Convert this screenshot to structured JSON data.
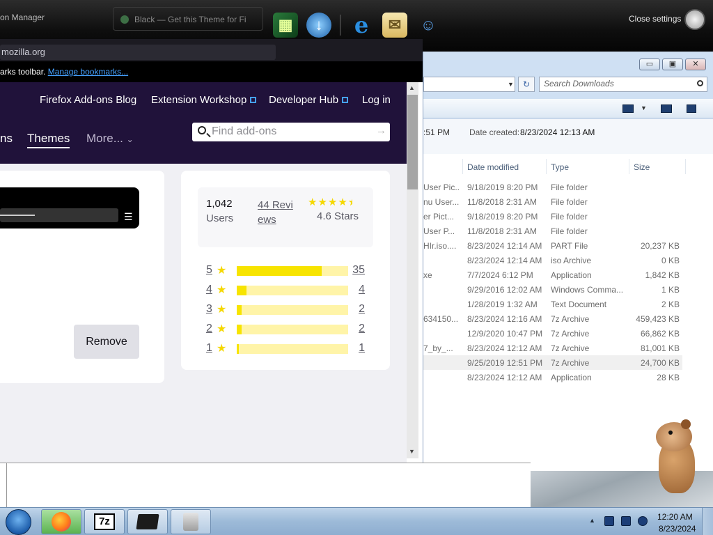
{
  "top_bar": {
    "firefox_tab_title": "on Manager",
    "ghost_tab_title": "Black — Get this Theme for Fi",
    "dock_icons": [
      "cube-app-icon",
      "globe-download-icon",
      "internet-explorer-icon",
      "mail-envelope-icon",
      "users-icon"
    ],
    "close_settings": "Close settings"
  },
  "firefox": {
    "url_text": "mozilla.org",
    "bookmarks_text": "arks toolbar.",
    "manage_bookmarks": "Manage bookmarks...",
    "header_links": [
      "Firefox Add-ons Blog",
      "Extension Workshop",
      "Developer Hub",
      "Log in"
    ],
    "nav": {
      "extensions_partial": "ns",
      "themes": "Themes",
      "more": "More..."
    },
    "search_placeholder": "Find add-ons",
    "remove_button": "Remove",
    "stats": {
      "users_count": "1,042",
      "users_label": "Users",
      "reviews_link": "44 Reviews",
      "stars_label": "4.6 Stars",
      "star_rating": 4.6
    },
    "ratings": [
      {
        "stars": "5",
        "count": "35",
        "fraction": 0.76
      },
      {
        "stars": "4",
        "count": "4",
        "fraction": 0.09
      },
      {
        "stars": "3",
        "count": "2",
        "fraction": 0.045
      },
      {
        "stars": "2",
        "count": "2",
        "fraction": 0.045
      },
      {
        "stars": "1",
        "count": "1",
        "fraction": 0.02
      }
    ]
  },
  "explorer": {
    "search_placeholder": "Search Downloads",
    "details": {
      "time_partial": ":51 PM",
      "created_label": "Date created:",
      "created_value": "8/23/2024 12:13 AM"
    },
    "columns": [
      "Date modified",
      "Type",
      "Size"
    ],
    "files": [
      {
        "name": "User Pic...",
        "date": "9/18/2019 8:20 PM",
        "type": "File folder",
        "size": ""
      },
      {
        "name": "nu User...",
        "date": "11/8/2018 2:31 AM",
        "type": "File folder",
        "size": ""
      },
      {
        "name": "er Pict...",
        "date": "9/18/2019 8:20 PM",
        "type": "File folder",
        "size": ""
      },
      {
        "name": "User P...",
        "date": "11/8/2018 2:31 AM",
        "type": "File folder",
        "size": ""
      },
      {
        "name": "HIr.iso....",
        "date": "8/23/2024 12:14 AM",
        "type": "PART File",
        "size": "20,237 KB"
      },
      {
        "name": "",
        "date": "8/23/2024 12:14 AM",
        "type": "iso Archive",
        "size": "0 KB"
      },
      {
        "name": "xe",
        "date": "7/7/2024 6:12 PM",
        "type": "Application",
        "size": "1,842 KB"
      },
      {
        "name": "",
        "date": "9/29/2016 12:02 AM",
        "type": "Windows Comma...",
        "size": "1 KB"
      },
      {
        "name": "",
        "date": "1/28/2019 1:32 AM",
        "type": "Text Document",
        "size": "2 KB"
      },
      {
        "name": "634150...",
        "date": "8/23/2024 12:16 AM",
        "type": "7z Archive",
        "size": "459,423 KB"
      },
      {
        "name": "",
        "date": "12/9/2020 10:47 PM",
        "type": "7z Archive",
        "size": "66,862 KB"
      },
      {
        "name": "7_by_...",
        "date": "8/23/2024 12:12 AM",
        "type": "7z Archive",
        "size": "81,001 KB"
      },
      {
        "name": "",
        "date": "9/25/2019 12:51 PM",
        "type": "7z Archive",
        "size": "24,700 KB",
        "selected": true
      },
      {
        "name": "",
        "date": "8/23/2024 12:12 AM",
        "type": "Application",
        "size": "28 KB"
      }
    ]
  },
  "taskbar": {
    "apps": [
      "firefox-app",
      "7zip-app",
      "black-box-app",
      "tool-app"
    ],
    "sevenzip_label": "7z",
    "clock_time": "12:20 AM",
    "clock_date": "8/23/2024"
  }
}
